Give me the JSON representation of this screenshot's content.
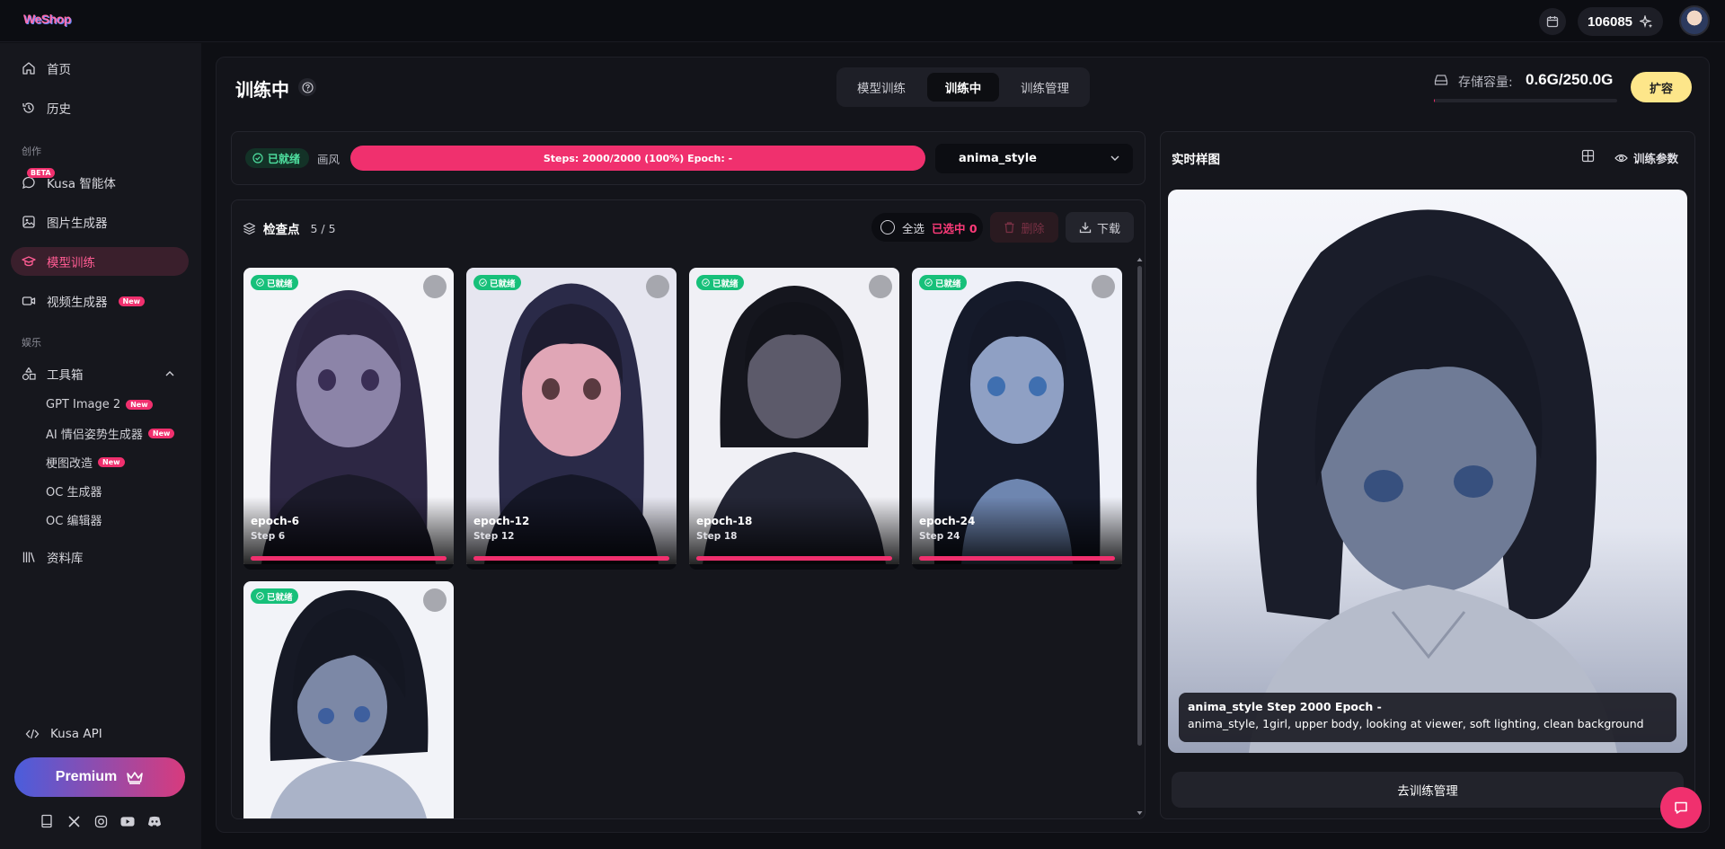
{
  "app": {
    "logo": "WeShop",
    "credits": "106085"
  },
  "sidebar": {
    "items": [
      {
        "label": "首页",
        "icon": "home-icon"
      },
      {
        "label": "历史",
        "icon": "history-icon"
      },
      {
        "label": "Kusa 智能体",
        "icon": "chat-icon",
        "badge": "BETA"
      },
      {
        "label": "图片生成器",
        "icon": "image-icon"
      },
      {
        "label": "模型训练",
        "icon": "graduation-cap-icon",
        "active": true
      },
      {
        "label": "视频生成器",
        "icon": "video-icon",
        "badge": "New"
      }
    ],
    "section_create": "创作",
    "section_entertainment": "娱乐",
    "toolbox": {
      "label": "工具箱",
      "items": [
        {
          "label": "GPT Image 2",
          "badge": "New"
        },
        {
          "label": "AI 情侣姿势生成器",
          "badge": "New"
        },
        {
          "label": "梗图改造",
          "badge": "New"
        },
        {
          "label": "OC 生成器"
        },
        {
          "label": "OC 编辑器"
        }
      ]
    },
    "library": "资料库",
    "api": "Kusa API",
    "premium": "Premium"
  },
  "header": {
    "title": "训练中",
    "tabs": [
      "模型训练",
      "训练中",
      "训练管理"
    ],
    "active_tab": "训练中",
    "storage_label": "存储容量:",
    "storage_value": "0.6G/250.0G",
    "storage_fraction": 0.0024,
    "expand_button": "扩容"
  },
  "status_bar": {
    "ready": "已就绪",
    "style_label": "画风",
    "progress_text": "Steps: 2000/2000 (100%) Epoch: -",
    "progress": 1.0,
    "model_select": "anima_style"
  },
  "checkpoints": {
    "title": "检查点",
    "count": "5 / 5",
    "select_all": "全选",
    "selected": "已选中 0",
    "delete": "删除",
    "download": "下载",
    "items": [
      {
        "status": "已就绪",
        "epoch": "epoch-6",
        "step": "Step 6"
      },
      {
        "status": "已就绪",
        "epoch": "epoch-12",
        "step": "Step 12"
      },
      {
        "status": "已就绪",
        "epoch": "epoch-18",
        "step": "Step 18"
      },
      {
        "status": "已就绪",
        "epoch": "epoch-24",
        "step": "Step 24"
      },
      {
        "status": "已就绪",
        "epoch": "",
        "step": ""
      }
    ]
  },
  "preview": {
    "title": "实时样图",
    "params_button": "训练参数",
    "caption_title": "anima_style Step 2000 Epoch -",
    "caption_prompt": "anima_style, 1girl, upper body, looking at viewer, soft lighting, clean background",
    "manage_button": "去训练管理"
  },
  "colors": {
    "accent": "#f0306e",
    "ready_green": "#17c07a",
    "expand_yellow": "#fde68a"
  }
}
